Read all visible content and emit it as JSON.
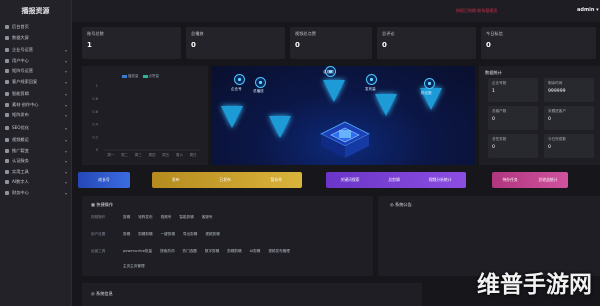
{
  "brand": "播报资源",
  "top": {
    "warning": "授权已到期 联系管理员",
    "user": "admin ▾"
  },
  "sidebar": {
    "items": [
      {
        "label": "后台首页",
        "chevron": ""
      },
      {
        "label": "数据大屏",
        "chevron": ""
      },
      {
        "label": "企业号运营",
        "chevron": "▾"
      },
      {
        "label": "用户中心",
        "chevron": "▾"
      },
      {
        "label": "矩阵号运营",
        "chevron": "▾"
      },
      {
        "label": "客户线索回复",
        "chevron": "▾"
      },
      {
        "label": "智能剪辑",
        "chevron": "▾"
      },
      {
        "label": "素材·创作中心",
        "chevron": "▾"
      },
      {
        "label": "矩阵发布",
        "chevron": "▾"
      },
      {
        "label": "SEO优化",
        "chevron": "▾"
      },
      {
        "label": "视频搬运",
        "chevron": "▾"
      },
      {
        "label": "推广裂变",
        "chevron": "▾"
      },
      {
        "label": "认证服务",
        "chevron": "▾"
      },
      {
        "label": "实用工具",
        "chevron": "▾"
      },
      {
        "label": "AI数字人",
        "chevron": "▾"
      },
      {
        "label": "财务中心",
        "chevron": "▾"
      }
    ]
  },
  "stats": [
    {
      "label": "账号总数",
      "value": "1"
    },
    {
      "label": "总播放",
      "value": "0"
    },
    {
      "label": "视频总点赞",
      "value": "0"
    },
    {
      "label": "总评论",
      "value": "0"
    },
    {
      "label": "今日私信",
      "value": "0"
    }
  ],
  "chart_data": {
    "type": "bar",
    "series": [
      {
        "name": "播放量",
        "values": [
          0,
          0,
          0,
          0,
          0,
          0,
          0
        ],
        "color": "#3a7bd5"
      },
      {
        "name": "点赞量",
        "values": [
          0,
          0,
          0,
          0,
          0,
          0,
          0
        ],
        "color": "#2fb39a"
      }
    ],
    "categories": [
      "周一",
      "周二",
      "周三",
      "周四",
      "周五",
      "周六",
      "周日"
    ],
    "yticks": [
      "1",
      "0.8",
      "0.6",
      "0.4",
      "0.2",
      "0"
    ],
    "ylim": [
      0,
      1
    ],
    "legend": "top",
    "grid": false
  },
  "visual": {
    "labels": [
      "企业号",
      "总播放",
      "总视频",
      "发布量",
      "粉丝数"
    ]
  },
  "right_panel": {
    "title": "数据统计",
    "items": [
      {
        "label": "企业号数",
        "value": "1"
      },
      {
        "label": "剩余时间",
        "value": "999999"
      },
      {
        "label": "总客户数",
        "value": "0"
      },
      {
        "label": "未跟进客户",
        "value": "0"
      },
      {
        "label": "总任务数",
        "value": "0"
      },
      {
        "label": "今日完成数",
        "value": "0"
      }
    ]
  },
  "bars": [
    {
      "labels": [
        "成长号"
      ],
      "color": "#2d5fd6"
    },
    {
      "labels": [
        "发布",
        "已发布",
        "暂存作"
      ],
      "color": "#caa42b"
    },
    {
      "labels": [
        "关键词搜索",
        "总剪辑",
        "视频分析统计"
      ],
      "color": "#7a3fd0"
    },
    {
      "labels": [
        "待办任务",
        "总收益统计"
      ],
      "color": "#c2428e"
    }
  ],
  "shortcut": {
    "title": "快捷操作",
    "rows": [
      {
        "cat": "视频操作",
        "links": [
          "剪辑",
          "矩阵发布",
          "视频号",
          "智能剪辑",
          "客服号"
        ]
      },
      {
        "cat": "用户设置",
        "links": [
          "剪辑",
          "剪辑剪辑",
          "一键剪辑",
          "导出剪辑",
          "视频剪辑"
        ]
      },
      {
        "cat": "运营工具",
        "links": [
          "powerscribe批量",
          "搜索热词",
          "热门选题",
          "数字剪辑",
          "剪辑剪辑",
          "AI剪辑",
          "视频发布管理"
        ]
      },
      {
        "cat": "",
        "links": [
          "主页主页管理"
        ]
      }
    ]
  },
  "notice": {
    "title": "系统公告"
  },
  "system_panel": {
    "title": "系统信息"
  },
  "watermark": "维普手游网",
  "colors": {
    "accent_blue": "#2d5fd6",
    "accent_gold": "#caa42b",
    "accent_purple": "#7a3fd0",
    "accent_pink": "#c2428e"
  }
}
